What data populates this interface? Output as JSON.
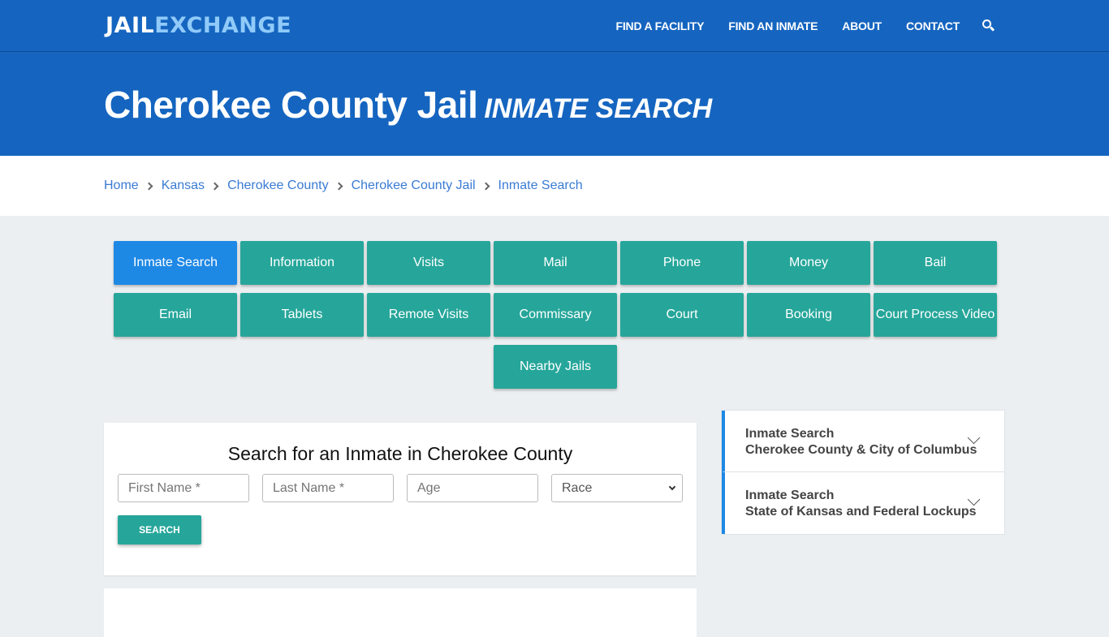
{
  "header": {
    "logo_part1": "JAIL",
    "logo_part2": "EXCHANGE",
    "nav": [
      "FIND A FACILITY",
      "FIND AN INMATE",
      "ABOUT",
      "CONTACT"
    ],
    "search_icon": "search-icon"
  },
  "hero": {
    "title": "Cherokee County Jail",
    "subtitle": "INMATE SEARCH"
  },
  "breadcrumb": [
    "Home",
    "Kansas",
    "Cherokee County",
    "Cherokee County Jail",
    "Inmate Search"
  ],
  "tiles": [
    {
      "label": "Inmate Search",
      "active": true
    },
    {
      "label": "Information"
    },
    {
      "label": "Visits"
    },
    {
      "label": "Mail"
    },
    {
      "label": "Phone"
    },
    {
      "label": "Money"
    },
    {
      "label": "Bail"
    },
    {
      "label": "Email"
    },
    {
      "label": "Tablets"
    },
    {
      "label": "Remote Visits"
    },
    {
      "label": "Commissary"
    },
    {
      "label": "Court"
    },
    {
      "label": "Booking"
    },
    {
      "label": "Court Process Video"
    },
    {
      "label": "Nearby Jails"
    }
  ],
  "search_form": {
    "title": "Search for an Inmate in Cherokee County",
    "first_name_placeholder": "First Name *",
    "last_name_placeholder": "Last Name *",
    "age_placeholder": "Age",
    "race_selected": "Race",
    "submit_label": "SEARCH"
  },
  "sidebar": {
    "items": [
      {
        "line1": "Inmate Search",
        "line2": "Cherokee County & City of Columbus"
      },
      {
        "line1": "Inmate Search",
        "line2": "State of Kansas and Federal Lockups"
      }
    ]
  },
  "colors": {
    "brand_blue": "#1565c0",
    "tile_teal": "#26a69a",
    "tile_active": "#1e88e5",
    "link": "#3a7bd5"
  }
}
